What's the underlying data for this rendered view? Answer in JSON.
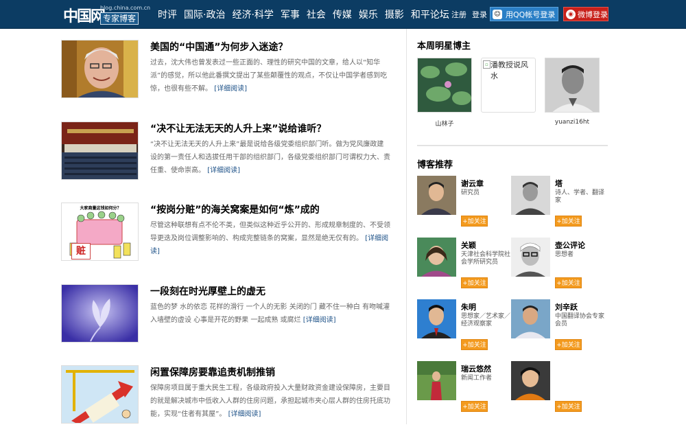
{
  "header": {
    "logo_text": "中国网",
    "logo_url": "blog.china.com.cn",
    "logo_tag": "专家博客",
    "nav": [
      "时评",
      "国际·政治",
      "经济·科学",
      "军事",
      "社会",
      "传媒",
      "娱乐",
      "摄影",
      "和平论坛"
    ],
    "register": "注册",
    "login": "登录",
    "qq_login": "用QQ帐号登录",
    "weibo_login": "微博登录"
  },
  "articles": [
    {
      "title": "美国的“中国通”为何步入迷途？",
      "summary": "过去，沈大伟也曾发表过一些正面的、理性的研究中国的文章，给人以“知华派”的感觉，所以他此番撰文提出了某些颠覆性的观点，不仅让中国学者感到吃惊，也很有些不解。",
      "more": "[详细阅读]"
    },
    {
      "title": "“决不让无法无天的人升上来”说给谁听？",
      "summary": "“决不让无法无天的人升上来”最是说给各级党委组织部门听。做为党风廉政建设的第一责任人和选拔任用干部的组织部门，各级党委组织部门可谓权力大、责任重、使命崇高。",
      "more": "[详细阅读]"
    },
    {
      "title": "“按岗分赃”的海关窝案是如何“炼”成的",
      "summary": "尽管这种联想有点不伦不类，但类似这种近乎公开的、形成规章制度的、不受领导更迭及岗位调整影响的、构成完整链条的窝案，显然是绝无仅有的。",
      "more": "[详细阅读]",
      "thumb_caption": "大家商量这钱如何分？",
      "thumb_sign": "赃"
    },
    {
      "title": "一段刻在时光厚壁上的虚无",
      "summary": "蓝色的梦 水的依恋 花样的滑行 一个人的无影 关闭的门 藏不住一种白 有吻喊灌入墙壁的虚设 心事是开花的野果 一起成熟 或腐烂",
      "more": "[详细阅读]"
    },
    {
      "title": "闲置保障房要靠追责机制推销",
      "summary": "保障房项目属于重大民生工程，各级政府投入大量财政资金建设保障房，主要目的就是解决城市中低收入人群的住房问题，承担起城市夹心层人群的住房托底功能，实现“住者有其屋”。",
      "more": "[详细阅读]"
    }
  ],
  "sidebar": {
    "stars_title": "本周明星博主",
    "stars": [
      {
        "name": "山林子"
      },
      {
        "name": "",
        "alt": "潘教授说风水"
      },
      {
        "name": "yuanzi16ht"
      }
    ],
    "bloggers_title": "博客推荐",
    "follow_label": "+加关注",
    "bloggers": [
      {
        "name": "谢云章",
        "desc": "研究员"
      },
      {
        "name": "塔",
        "desc": "诗人、学者、翻译家"
      },
      {
        "name": "关颖",
        "desc": "天津社会科学院社会学所研究员"
      },
      {
        "name": "壶公评论",
        "desc": "思想者"
      },
      {
        "name": "朱明",
        "desc": "思想家／艺术家／经济观察家"
      },
      {
        "name": "刘辛跃",
        "desc": "中国翻译协会专家会员"
      },
      {
        "name": "瑞云悠然",
        "desc": "新闻工作者"
      },
      {
        "name": "",
        "desc": ""
      }
    ]
  },
  "colors": {
    "header_bg": "#0c3c63",
    "link": "#1a4f86",
    "follow_btn": "#f39a1e",
    "qq_btn": "#2a7fc6",
    "weibo_btn": "#c8201a"
  }
}
